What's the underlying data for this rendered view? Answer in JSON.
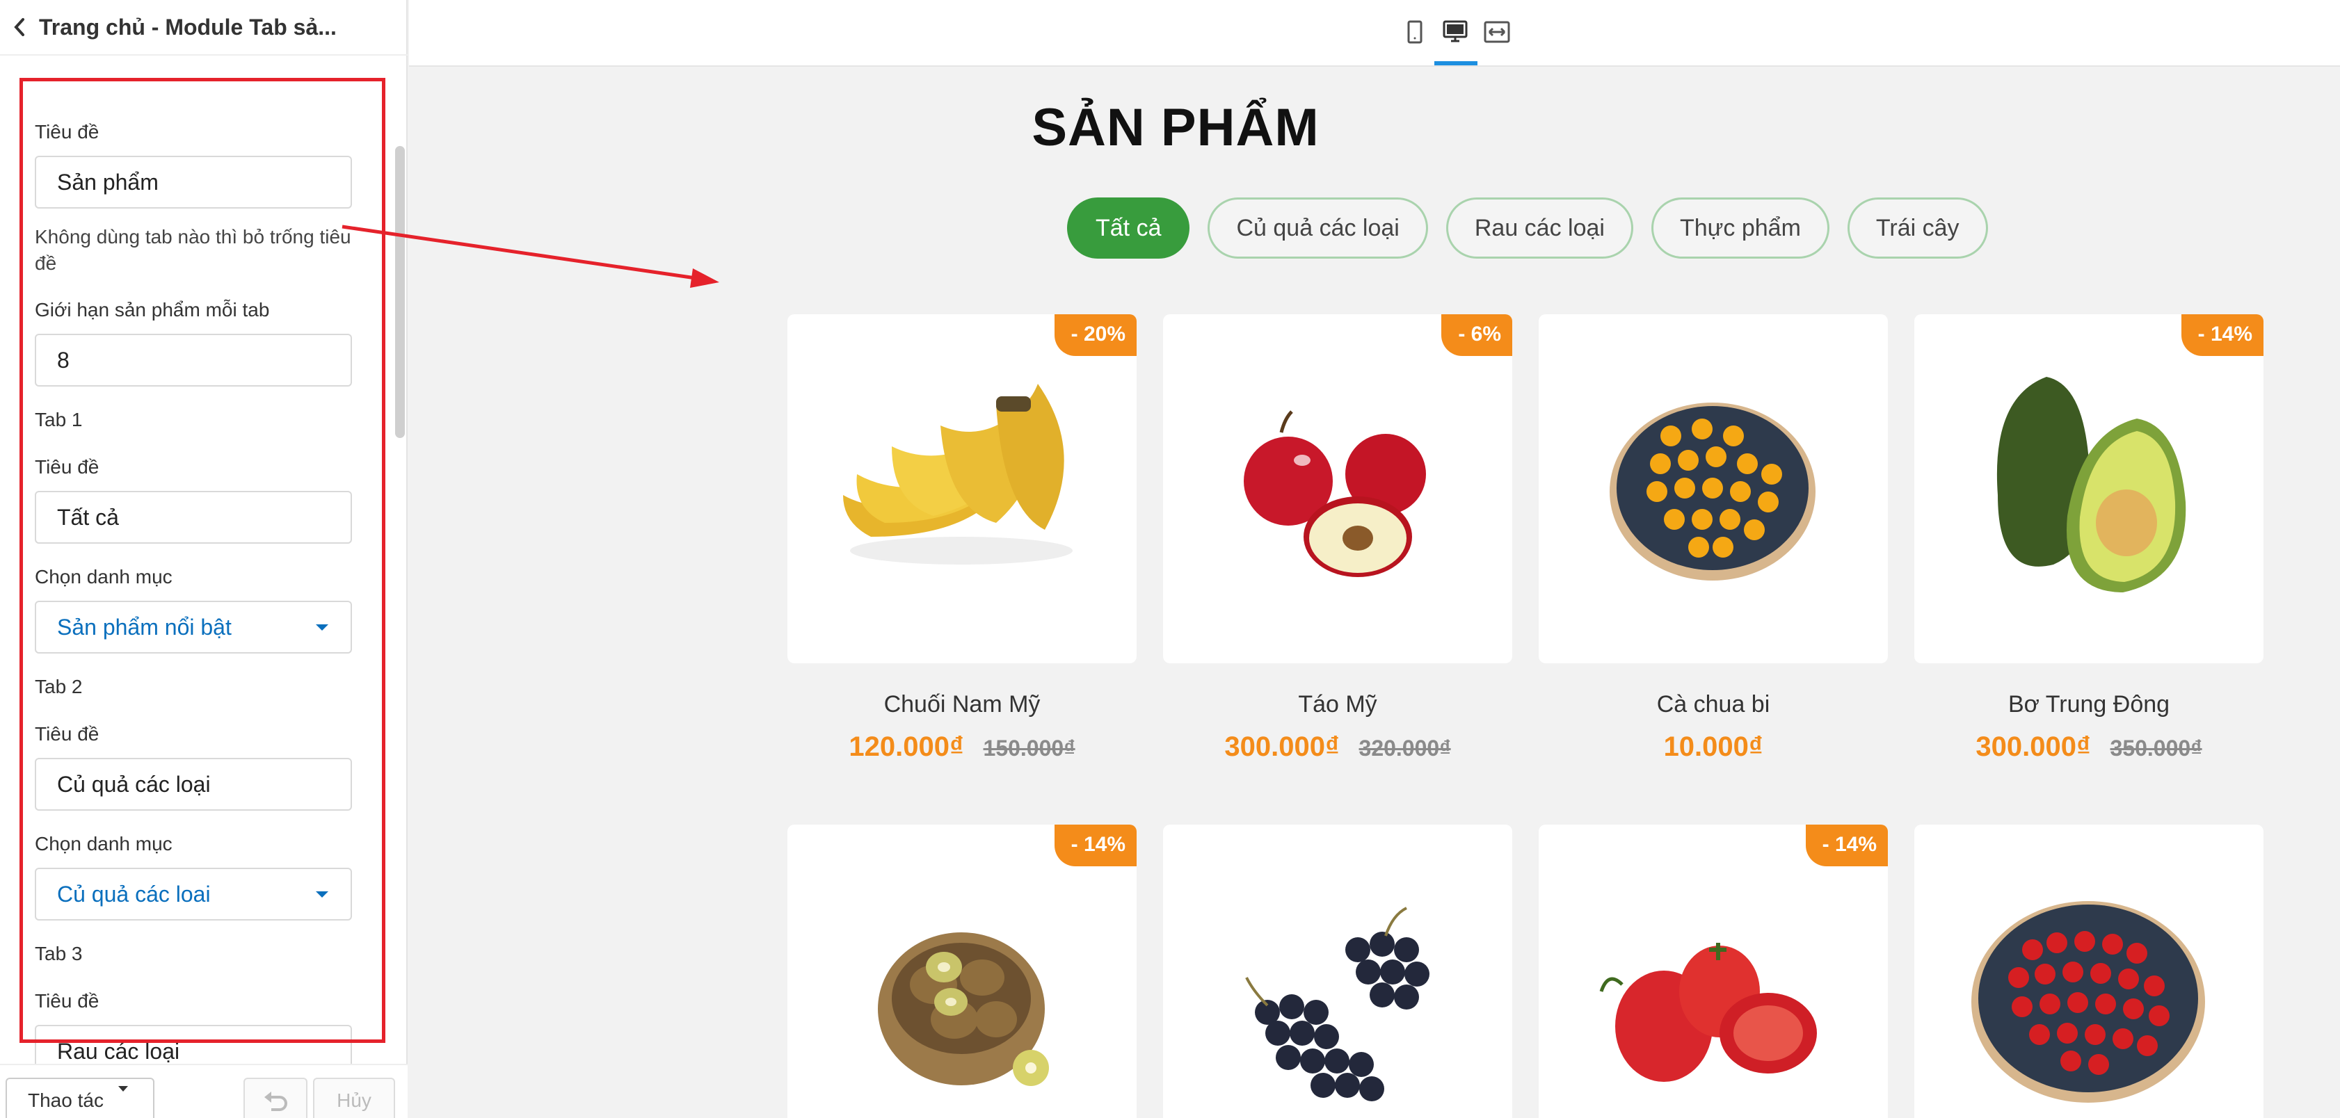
{
  "sidebar": {
    "title": "Trang chủ - Module Tab sả...",
    "fields": {
      "title_label": "Tiêu đề",
      "title_value": "Sản phẩm",
      "note": "Không dùng tab nào thì bỏ trống tiêu đề",
      "limit_label": "Giới hạn sản phẩm mỗi tab",
      "limit_value": "8"
    },
    "tabs": [
      {
        "heading": "Tab 1",
        "title_label": "Tiêu đề",
        "title_value": "Tất cả",
        "category_label": "Chọn danh mục",
        "category_value": "Sản phẩm nổi bật"
      },
      {
        "heading": "Tab 2",
        "title_label": "Tiêu đề",
        "title_value": "Củ quả các loại",
        "category_label": "Chọn danh mục",
        "category_value": "Củ quả các loai"
      },
      {
        "heading": "Tab 3",
        "title_label": "Tiêu đề",
        "title_value": "Rau các loại"
      }
    ],
    "footer": {
      "actions_label": "Thao tác",
      "cancel_label": "Hủy"
    }
  },
  "topbar": {
    "devices": [
      "mobile-icon",
      "desktop-icon",
      "fullwidth-icon"
    ],
    "active_device": "desktop-icon"
  },
  "preview": {
    "section_title": "SẢN PHẨM",
    "tabs": [
      "Tất cả",
      "Củ quả các loại",
      "Rau các loại",
      "Thực phẩm",
      "Trái cây"
    ],
    "active_tab": "Tất cả",
    "products": [
      {
        "name": "Chuối Nam Mỹ",
        "price": "120.000₫",
        "old_price": "150.000₫",
        "badge": "- 20%",
        "image": "banana"
      },
      {
        "name": "Táo Mỹ",
        "price": "300.000₫",
        "old_price": "320.000₫",
        "badge": "- 6%",
        "image": "apple"
      },
      {
        "name": "Cà chua bi",
        "price": "10.000₫",
        "old_price": "",
        "badge": "",
        "image": "yellow-tomatoes"
      },
      {
        "name": "Bơ Trung Đông",
        "price": "300.000₫",
        "old_price": "350.000₫",
        "badge": "- 14%",
        "image": "avocado"
      },
      {
        "badge": "- 14%",
        "image": "kiwi"
      },
      {
        "badge": "",
        "image": "grapes"
      },
      {
        "badge": "- 14%",
        "image": "red-tomatoes"
      },
      {
        "badge": "",
        "image": "cherry-tomatoes"
      }
    ]
  },
  "colors": {
    "accent_green": "#389c3d",
    "price_orange": "#f48c1a",
    "annotation_red": "#e5222b",
    "select_blue": "#0a6fbd"
  }
}
